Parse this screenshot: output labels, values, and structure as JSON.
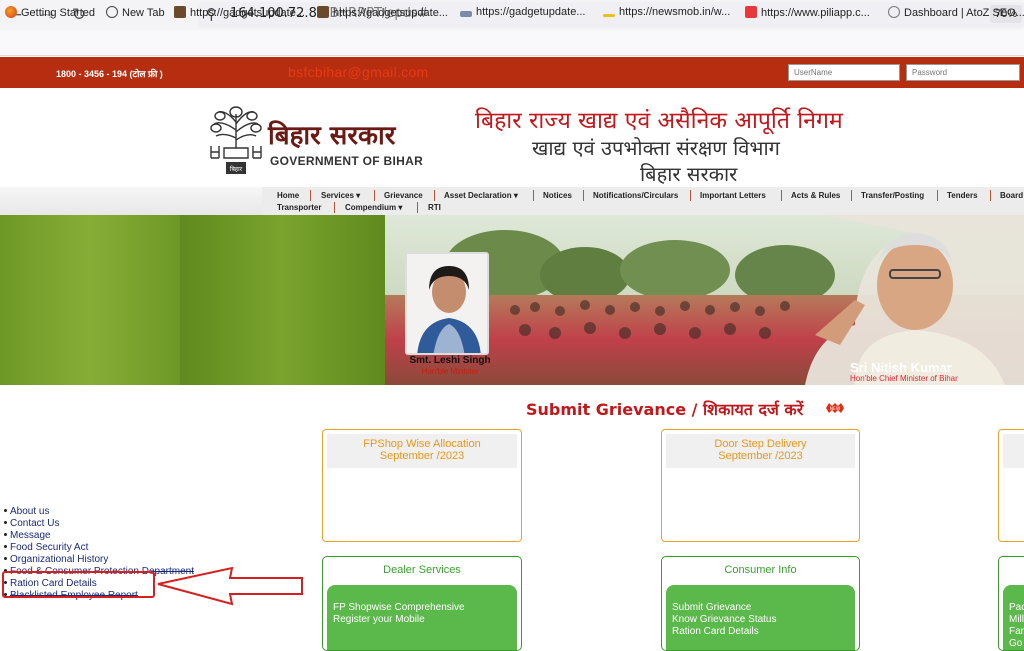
{
  "browser": {
    "url_host": "164.100.72.83",
    "url_path": "/BHRRPT/epds#",
    "zoom": "70%",
    "bookmarks": [
      {
        "label": "Getting Started",
        "icon": "firefox-icon"
      },
      {
        "label": "New Tab",
        "icon": "globe-icon"
      },
      {
        "label": "https://gadgetsupdate...",
        "icon": "site-icon"
      },
      {
        "label": "https://gadgetsupdate...",
        "icon": "site-icon"
      },
      {
        "label": "https://gadgetupdate...",
        "icon": "site-icon"
      },
      {
        "label": "https://newsmob.in/w...",
        "icon": "site-icon"
      },
      {
        "label": "https://www.piliapp.c...",
        "icon": "piliapp-icon"
      },
      {
        "label": "Dashboard | AtoZ SEO...",
        "icon": "dashboard-icon"
      }
    ]
  },
  "topbar": {
    "helpline": "1800 - 3456 - 194 (टोल फ्री )",
    "email": "bsfcbihar@gmail.com",
    "username_placeholder": "UserName",
    "password_placeholder": "Password"
  },
  "header": {
    "govt_hindi": "बिहार सरकार",
    "govt_english": "GOVERNMENT OF BIHAR",
    "line1": "बिहार राज्य खाद्य एवं असैनिक आपूर्ति निगम",
    "line2": "खाद्य एवं उपभोक्ता संरक्षण विभाग",
    "line3": "बिहार सरकार"
  },
  "menu": {
    "row1": [
      "Home",
      "Services",
      "Grievance",
      "Asset Declaration",
      "Notices",
      "Notifications/Circulars",
      "Important Letters",
      "Acts & Rules",
      "Transfer/Posting",
      "Tenders",
      "Board"
    ],
    "row2": [
      "Transporter",
      "Compendium",
      "RTI"
    ]
  },
  "banner": {
    "minister_name": "Smt. Leshi Singh",
    "minister_role": "Hon'ble Minister",
    "cm_name": "Sri Nitish Kumar",
    "cm_role": "Hon'ble Chief Minister of Bihar"
  },
  "content": {
    "grievance_title": "Submit Grievance / शिकायत दर्ज करें",
    "new_badge": "NEW",
    "card1_title": "FPShop Wise Allocation",
    "card1_sub": "September /2023",
    "card2_title": "Door Step Delivery",
    "card2_sub": "September /2023",
    "dealer_title": "Dealer Services",
    "dealer_items": [
      "FP Shopwise Comprehensive",
      "Register your Mobile"
    ],
    "consumer_title": "Consumer Info",
    "consumer_items": [
      "Submit Grievance",
      "Know Grievance Status",
      "Ration Card Details"
    ],
    "partial_items": [
      "Pac",
      "Mill",
      "Far",
      "Go"
    ]
  },
  "left_links": [
    "About us",
    "Contact Us",
    "Message",
    "Food Security Act",
    "Organizational History",
    "Food & Consumer Protection Department",
    "Ration Card Details",
    "Blacklisted Employee Report"
  ]
}
